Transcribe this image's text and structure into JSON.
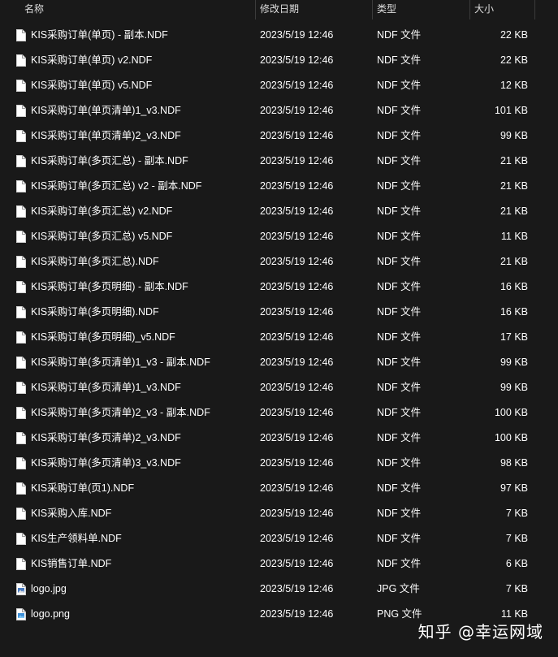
{
  "header": {
    "name": "名称",
    "date": "修改日期",
    "type": "类型",
    "size": "大小"
  },
  "files": [
    {
      "name": "KIS采购订单(单页) - 副本.NDF",
      "date": "2023/5/19 12:46",
      "type": "NDF 文件",
      "size": "22 KB",
      "icon": "document-icon"
    },
    {
      "name": "KIS采购订单(单页) v2.NDF",
      "date": "2023/5/19 12:46",
      "type": "NDF 文件",
      "size": "22 KB",
      "icon": "document-icon"
    },
    {
      "name": "KIS采购订单(单页) v5.NDF",
      "date": "2023/5/19 12:46",
      "type": "NDF 文件",
      "size": "12 KB",
      "icon": "document-icon"
    },
    {
      "name": "KIS采购订单(单页清单)1_v3.NDF",
      "date": "2023/5/19 12:46",
      "type": "NDF 文件",
      "size": "101 KB",
      "icon": "document-icon"
    },
    {
      "name": "KIS采购订单(单页清单)2_v3.NDF",
      "date": "2023/5/19 12:46",
      "type": "NDF 文件",
      "size": "99 KB",
      "icon": "document-icon"
    },
    {
      "name": "KIS采购订单(多页汇总) - 副本.NDF",
      "date": "2023/5/19 12:46",
      "type": "NDF 文件",
      "size": "21 KB",
      "icon": "document-icon"
    },
    {
      "name": "KIS采购订单(多页汇总) v2 - 副本.NDF",
      "date": "2023/5/19 12:46",
      "type": "NDF 文件",
      "size": "21 KB",
      "icon": "document-icon"
    },
    {
      "name": "KIS采购订单(多页汇总) v2.NDF",
      "date": "2023/5/19 12:46",
      "type": "NDF 文件",
      "size": "21 KB",
      "icon": "document-icon"
    },
    {
      "name": "KIS采购订单(多页汇总) v5.NDF",
      "date": "2023/5/19 12:46",
      "type": "NDF 文件",
      "size": "11 KB",
      "icon": "document-icon"
    },
    {
      "name": "KIS采购订单(多页汇总).NDF",
      "date": "2023/5/19 12:46",
      "type": "NDF 文件",
      "size": "21 KB",
      "icon": "document-icon"
    },
    {
      "name": "KIS采购订单(多页明细) - 副本.NDF",
      "date": "2023/5/19 12:46",
      "type": "NDF 文件",
      "size": "16 KB",
      "icon": "document-icon"
    },
    {
      "name": "KIS采购订单(多页明细).NDF",
      "date": "2023/5/19 12:46",
      "type": "NDF 文件",
      "size": "16 KB",
      "icon": "document-icon"
    },
    {
      "name": "KIS采购订单(多页明细)_v5.NDF",
      "date": "2023/5/19 12:46",
      "type": "NDF 文件",
      "size": "17 KB",
      "icon": "document-icon"
    },
    {
      "name": "KIS采购订单(多页清单)1_v3 - 副本.NDF",
      "date": "2023/5/19 12:46",
      "type": "NDF 文件",
      "size": "99 KB",
      "icon": "document-icon"
    },
    {
      "name": "KIS采购订单(多页清单)1_v3.NDF",
      "date": "2023/5/19 12:46",
      "type": "NDF 文件",
      "size": "99 KB",
      "icon": "document-icon"
    },
    {
      "name": "KIS采购订单(多页清单)2_v3 - 副本.NDF",
      "date": "2023/5/19 12:46",
      "type": "NDF 文件",
      "size": "100 KB",
      "icon": "document-icon"
    },
    {
      "name": "KIS采购订单(多页清单)2_v3.NDF",
      "date": "2023/5/19 12:46",
      "type": "NDF 文件",
      "size": "100 KB",
      "icon": "document-icon"
    },
    {
      "name": "KIS采购订单(多页清单)3_v3.NDF",
      "date": "2023/5/19 12:46",
      "type": "NDF 文件",
      "size": "98 KB",
      "icon": "document-icon"
    },
    {
      "name": "KIS采购订单(页1).NDF",
      "date": "2023/5/19 12:46",
      "type": "NDF 文件",
      "size": "97 KB",
      "icon": "document-icon"
    },
    {
      "name": "KIS采购入库.NDF",
      "date": "2023/5/19 12:46",
      "type": "NDF 文件",
      "size": "7 KB",
      "icon": "document-icon"
    },
    {
      "name": "KIS生产领料单.NDF",
      "date": "2023/5/19 12:46",
      "type": "NDF 文件",
      "size": "7 KB",
      "icon": "document-icon"
    },
    {
      "name": "KIS销售订单.NDF",
      "date": "2023/5/19 12:46",
      "type": "NDF 文件",
      "size": "6 KB",
      "icon": "document-icon"
    },
    {
      "name": "logo.jpg",
      "date": "2023/5/19 12:46",
      "type": "JPG 文件",
      "size": "7 KB",
      "icon": "jpg-image-icon"
    },
    {
      "name": "logo.png",
      "date": "2023/5/19 12:46",
      "type": "PNG 文件",
      "size": "11 KB",
      "icon": "png-image-icon"
    }
  ],
  "watermark": "知乎 @幸运网域"
}
